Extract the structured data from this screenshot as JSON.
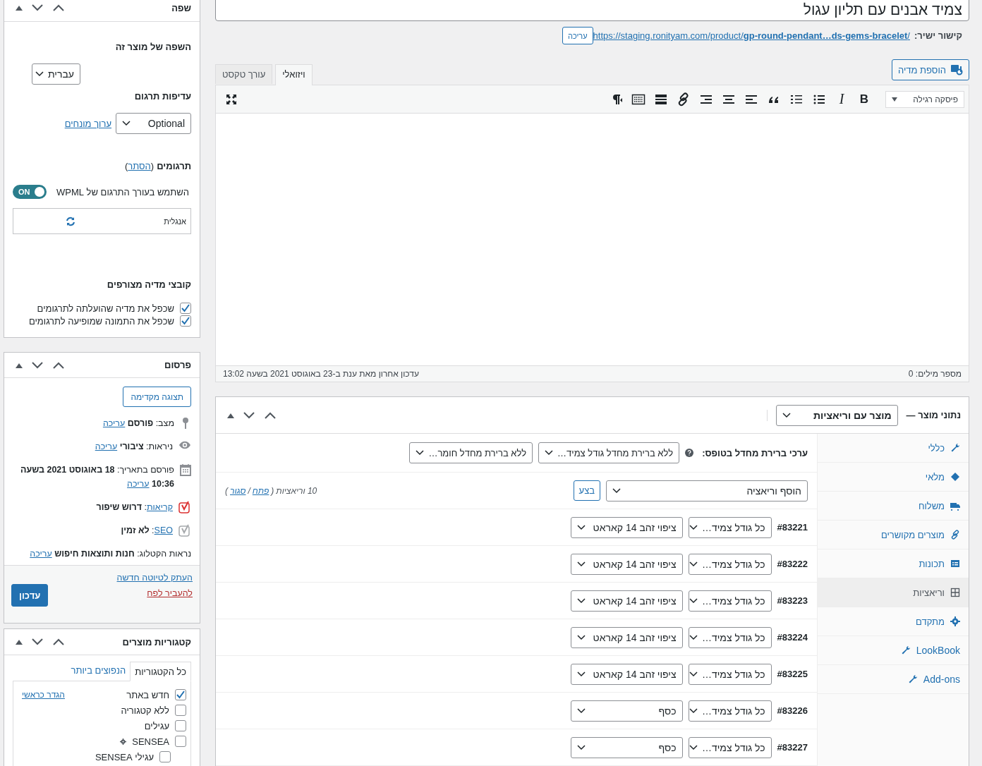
{
  "title_field": {
    "value": "צמיד אבנים עם תליון עגול"
  },
  "permalink": {
    "label": "קישור ישיר:",
    "url": "https://staging.ronityam.com/product/**gp-round-pendant…ds-gems-bracelet**/",
    "edit_button": "עריכה"
  },
  "add_media_button": "הוספת מדיה",
  "editor_tabs": [
    {
      "label": "ויזואלי",
      "selected": true
    },
    {
      "label": "עורך טקסט",
      "selected": false
    }
  ],
  "format_select": "פיסקה רגילה",
  "bold_button": "B",
  "italic_button": "I",
  "status_bar": {
    "word_count": "מספר מילים: 0",
    "last_edited": "עדכון אחרון מאת ענת ב-23 באוגוסט 2021 בשעה 13:02"
  },
  "product_data": {
    "title": "נתוני מוצר —",
    "type_select": "מוצר עם וריאציות",
    "tabs": [
      {
        "kind": "wrench",
        "label": "כללי",
        "selected": false
      },
      {
        "kind": "tag",
        "label": "מלאי",
        "selected": false
      },
      {
        "kind": "truck",
        "label": "משלוח",
        "selected": false
      },
      {
        "kind": "link",
        "label": "מוצרים מקושרים",
        "selected": false
      },
      {
        "kind": "card",
        "label": "תכונות",
        "selected": false
      },
      {
        "kind": "grid",
        "label": "וריאציות",
        "selected": true
      },
      {
        "kind": "gear",
        "label": "מתקדם",
        "selected": false
      },
      {
        "kind": "wrench-ltr",
        "label": "LookBook",
        "selected": false
      },
      {
        "kind": "wrench-ltr",
        "label": "Add-ons",
        "selected": false
      }
    ],
    "defaults_label": "ערכי ברירת מחדל בטופס:",
    "default_selects": [
      "ללא ברירת מחדל גודל צמיד…",
      "ללא ברירת מחדל חומר…"
    ],
    "add_select": "הוסף וריאציה",
    "go_button": "בצע",
    "count": "10 וריאציות",
    "open_paren": "(",
    "expand_link": "פתח",
    "separator": "/",
    "collapse_link": "סגור",
    "close_paren": ")",
    "variations": [
      {
        "id": "#83221",
        "size": "כל גודל צמיד…",
        "material": "ציפוי זהב 14 קאראט"
      },
      {
        "id": "#83222",
        "size": "כל גודל צמיד…",
        "material": "ציפוי זהב 14 קאראט"
      },
      {
        "id": "#83223",
        "size": "כל גודל צמיד…",
        "material": "ציפוי זהב 14 קאראט"
      },
      {
        "id": "#83224",
        "size": "כל גודל צמיד…",
        "material": "ציפוי זהב 14 קאראט"
      },
      {
        "id": "#83225",
        "size": "כל גודל צמיד…",
        "material": "ציפוי זהב 14 קאראט"
      },
      {
        "id": "#83226",
        "size": "כל גודל צמיד…",
        "material": "כסף"
      },
      {
        "id": "#83227",
        "size": "כל גודל צמיד…",
        "material": "כסף"
      }
    ]
  },
  "language_box": {
    "title": "שפה",
    "language_label": "השפה של מוצר זה",
    "language_select": "עברית",
    "priority_label": "עדיפות תרגום",
    "priority_select": "Optional",
    "terms_link": "ערוך מונחים",
    "translations_title": "תרגומים",
    "open_paren": "(",
    "hide_link": "הסתר",
    "close_paren": ")",
    "toggle": {
      "label": "השתמש בעורך התרגום של WPML",
      "on": true,
      "state_text": "ON"
    },
    "translation_language": "אנגלית",
    "media_title": "קובצי מדיה מצורפים",
    "media_options": [
      {
        "label": "שכפל את מדיה שהועלתה לתרגומים",
        "checked": true
      },
      {
        "label": "שכפל את התמונה שמופיעה לתרגומים",
        "checked": true
      }
    ]
  },
  "publish_box": {
    "title": "פרסום",
    "preview_button": "תצוגה מקדימה",
    "rows": [
      {
        "kind": "pin",
        "text": "מצב: **פורסם**",
        "link": "עריכה"
      },
      {
        "kind": "eye",
        "text": "ניראות: **ציבורי**",
        "link": "עריכה"
      },
      {
        "kind": "calendar",
        "text": "פורסם בתאריך: **18 באוגוסט 2021 בשעה**",
        "text_line2": "**10:36**",
        "link": "עריכה"
      },
      {
        "kind": "yoast-bad",
        "link": "קריאות",
        "text": ": **דרוש שיפור**"
      },
      {
        "kind": "yoast-none",
        "link": "SEO",
        "text": ": **לא זמין**"
      },
      {
        "kind": "plain",
        "text": "נראות הקטלוג: **חנות ותוצאות חיפוש**",
        "link": "עריכה"
      }
    ],
    "copy_link": "העתק לטיוטה חדשה",
    "trash_link": "להעביר לפח",
    "update_button": "עדכון"
  },
  "categories_box": {
    "title": "קטגוריות מוצרים",
    "tabs": [
      {
        "label": "כל הקטגוריות",
        "selected": true
      },
      {
        "label": "הנפוצים ביותר",
        "selected": false
      }
    ],
    "items": [
      {
        "label": "חדש באתר",
        "checked": true,
        "primary_link": "הגדר כראשי"
      },
      {
        "label": "ללא קטגוריה",
        "checked": false
      },
      {
        "label": "עגילים",
        "checked": false
      },
      {
        "label": "SENSEA",
        "checked": false,
        "children": [
          {
            "label": "עגילי SENSEA",
            "checked": false
          }
        ]
      }
    ]
  }
}
